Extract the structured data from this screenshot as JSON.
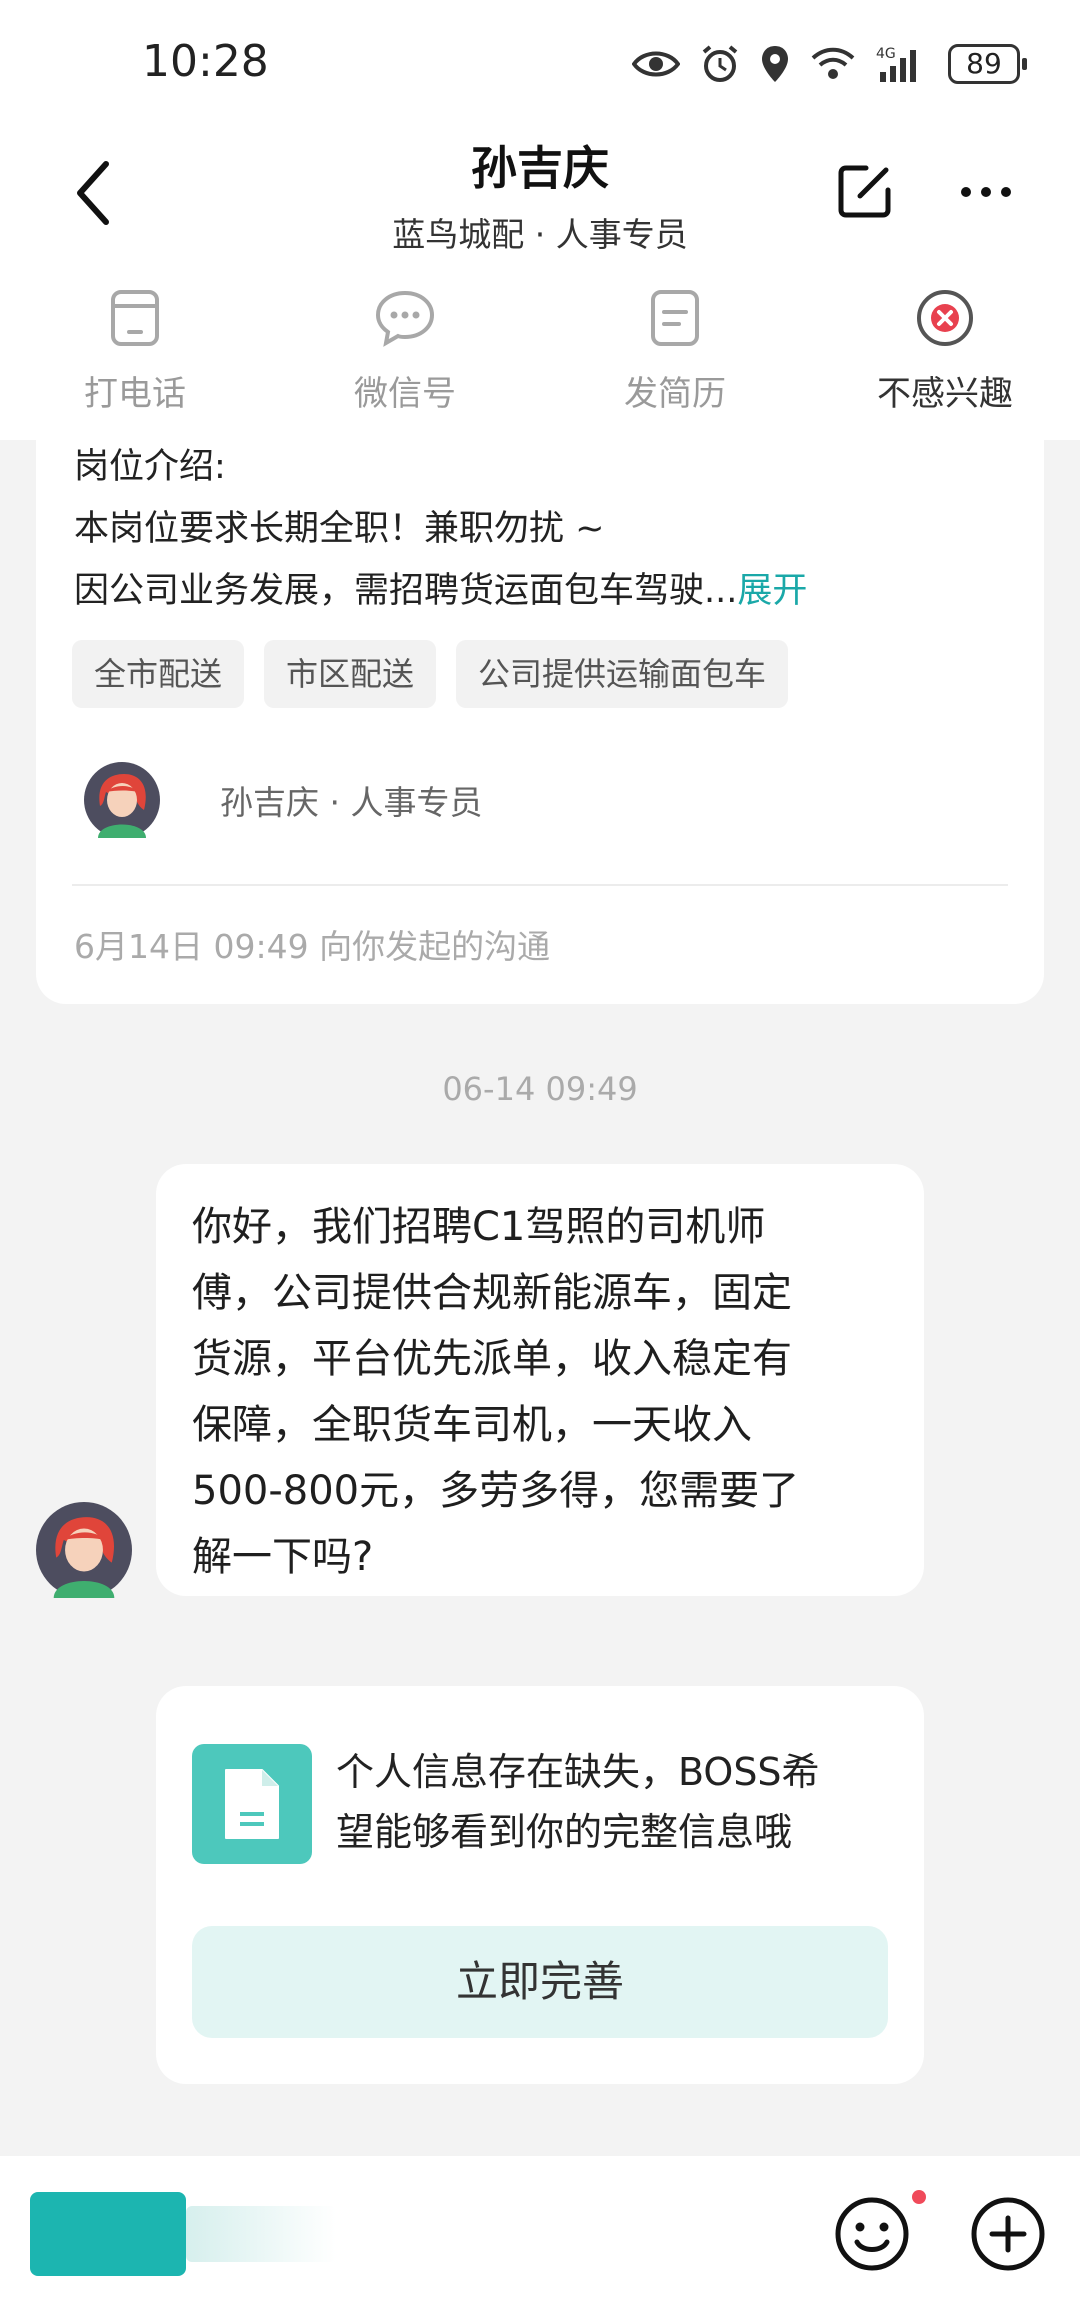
{
  "status_bar": {
    "time": "10:28",
    "battery": "89",
    "network": "4G"
  },
  "header": {
    "title": "孙吉庆",
    "subtitle": "蓝鸟城配 · 人事专员"
  },
  "actions": [
    {
      "label": "打电话",
      "icon": "phone-icon"
    },
    {
      "label": "微信号",
      "icon": "wechat-icon"
    },
    {
      "label": "发简历",
      "icon": "resume-icon"
    },
    {
      "label": "不感兴趣",
      "icon": "not-interested-icon"
    }
  ],
  "job_card": {
    "intro_heading": "岗位介绍:",
    "line1": "本岗位要求长期全职！兼职勿扰 ~",
    "line2": "因公司业务发展，需招聘货运面包车驾驶...",
    "expand_label": "展开",
    "tags": [
      "全市配送",
      "市区配送",
      "公司提供运输面包车"
    ],
    "recruiter": "孙吉庆 · 人事专员",
    "initiated": "6月14日 09:49 向你发起的沟通"
  },
  "chat": {
    "timestamp": "06-14 09:49",
    "message_lines": [
      "你好，我们招聘C1驾照的司机师",
      "傅，公司提供合规新能源车，固定",
      "货源，平台优先派单，收入稳定有",
      "保障，全职货车司机，一天收入",
      "500-800元，多劳多得，您需要了",
      "解一下吗?"
    ]
  },
  "profile_prompt": {
    "line1": "个人信息存在缺失，BOSS希",
    "line2": "望能够看到你的完整信息哦",
    "button_label": "立即完善"
  },
  "colors": {
    "accent": "#1aa8a8",
    "doc_icon_bg": "#4dc8bc",
    "button_bg": "#e2f5f3",
    "notify_dot": "#f04a5a",
    "not_interested_red": "#e8414f"
  }
}
